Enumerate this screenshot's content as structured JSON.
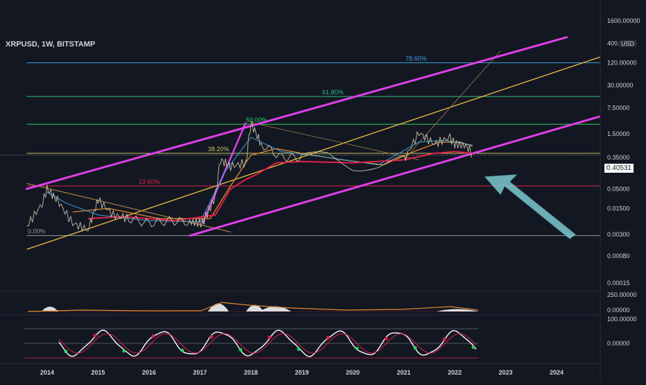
{
  "title": "XRPUSD, 1W, BITSTAMP",
  "current_price": "0.40531",
  "currency_tag": "USD",
  "colors": {
    "background": "#131722",
    "channel": "#e040e8",
    "trend_yellow": "#f0c040",
    "arrow": "#7ec8d0",
    "ma_red": "#e0204a",
    "ma_orange": "#e08a30",
    "ma_blue": "#3aa0d8",
    "candle_up": "#c8c0a8",
    "text": "#d1d4dc"
  },
  "chart_data": [
    {
      "type": "line",
      "subtype": "candlestick-price",
      "scale": "log",
      "x_ticks": [
        "2014",
        "2015",
        "2016",
        "2017",
        "2018",
        "2019",
        "2020",
        "2021",
        "2022",
        "2023",
        "2024"
      ],
      "y_ticks": [
        "1600.00000",
        "400.00000",
        "120.00000",
        "30.00000",
        "7.50000",
        "1.50000",
        "0.35000",
        "0.05000",
        "0.01500",
        "0.00300",
        "0.00080",
        "0.00015"
      ],
      "fib_levels": [
        {
          "label": "0.00%",
          "value": 0.0028
        },
        {
          "label": "23.60%",
          "value": 0.06
        },
        {
          "label": "38.20%",
          "value": 0.45
        },
        {
          "label": "50.00%",
          "value": 2.7
        },
        {
          "label": "61.80%",
          "value": 15
        },
        {
          "label": "78.60%",
          "value": 120
        }
      ],
      "price_series": [
        {
          "t": 2013.6,
          "v": 0.005
        },
        {
          "t": 2013.9,
          "v": 0.02
        },
        {
          "t": 2014.0,
          "v": 0.05
        },
        {
          "t": 2014.2,
          "v": 0.025
        },
        {
          "t": 2014.5,
          "v": 0.006
        },
        {
          "t": 2014.8,
          "v": 0.004
        },
        {
          "t": 2015.0,
          "v": 0.025
        },
        {
          "t": 2015.3,
          "v": 0.01
        },
        {
          "t": 2015.6,
          "v": 0.008
        },
        {
          "t": 2016.0,
          "v": 0.006
        },
        {
          "t": 2016.4,
          "v": 0.007
        },
        {
          "t": 2016.8,
          "v": 0.0065
        },
        {
          "t": 2017.05,
          "v": 0.006
        },
        {
          "t": 2017.3,
          "v": 0.03
        },
        {
          "t": 2017.4,
          "v": 0.3
        },
        {
          "t": 2017.6,
          "v": 0.2
        },
        {
          "t": 2017.9,
          "v": 0.25
        },
        {
          "t": 2018.0,
          "v": 3.0
        },
        {
          "t": 2018.2,
          "v": 0.8
        },
        {
          "t": 2018.6,
          "v": 0.35
        },
        {
          "t": 2019.0,
          "v": 0.35
        },
        {
          "t": 2019.5,
          "v": 0.4
        },
        {
          "t": 2020.0,
          "v": 0.2
        },
        {
          "t": 2020.5,
          "v": 0.2
        },
        {
          "t": 2021.0,
          "v": 0.3
        },
        {
          "t": 2021.3,
          "v": 1.6
        },
        {
          "t": 2021.6,
          "v": 0.8
        },
        {
          "t": 2021.9,
          "v": 1.2
        },
        {
          "t": 2022.0,
          "v": 0.8
        },
        {
          "t": 2022.25,
          "v": 0.7
        },
        {
          "t": 2022.35,
          "v": 0.405
        }
      ],
      "channel_lines": [
        {
          "from": {
            "t": 2013.6,
            "v": 0.05
          },
          "to": {
            "t": 2024.2,
            "v": 580
          }
        },
        {
          "from": {
            "t": 2016.8,
            "v": 0.0028
          },
          "to": {
            "t": 2025.0,
            "v": 5
          }
        }
      ],
      "trend_lines": [
        {
          "from": {
            "t": 2013.6,
            "v": 0.0012
          },
          "to": {
            "t": 2025.0,
            "v": 200
          }
        },
        {
          "from": {
            "t": 2013.6,
            "v": 0.07
          },
          "to": {
            "t": 2017.6,
            "v": 0.0035
          }
        }
      ]
    },
    {
      "type": "area",
      "subtype": "oscillator-1",
      "y_ticks": [
        "250.00000",
        "0.00000"
      ]
    },
    {
      "type": "line",
      "subtype": "oscillator-2",
      "y_ticks": [
        "100.00000",
        "0.00000"
      ]
    }
  ]
}
